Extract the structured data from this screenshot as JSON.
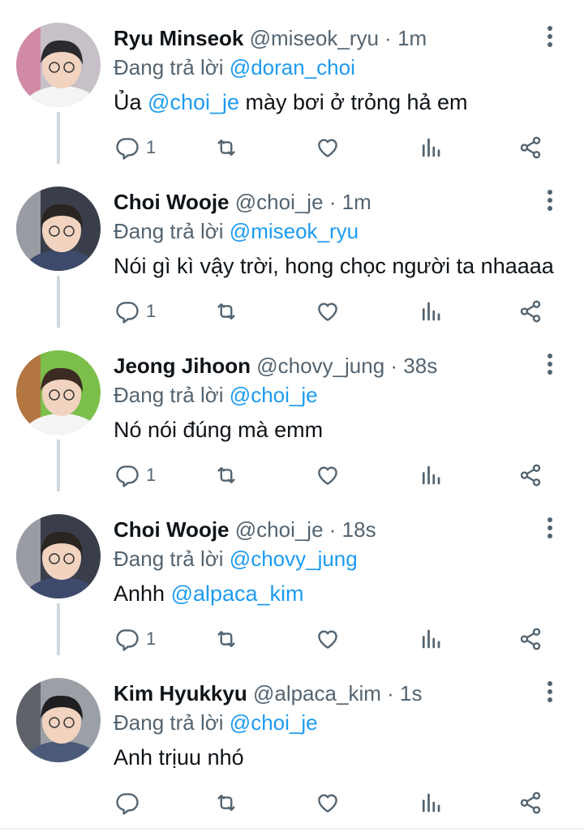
{
  "reply_prefix": "Đang trả lời",
  "colors": {
    "text": "#0f1419",
    "secondary": "#536471",
    "accent": "#1d9bf0",
    "thread": "#cfd9de"
  },
  "tweets": [
    {
      "name": "Ryu Minseok",
      "handle": "@miseok_ryu",
      "time": "1m",
      "reply_to": "@doran_choi",
      "text_before": "Ủa ",
      "text_mention": "@choi_je",
      "text_after": " mày bơi ở trỏng hả em",
      "reply_count": "1"
    },
    {
      "name": "Choi Wooje",
      "handle": "@choi_je",
      "time": "1m",
      "reply_to": "@miseok_ryu",
      "text_before": "Nói gì kì vậy trời, hong chọc người ta nhaaaa",
      "text_mention": "",
      "text_after": "",
      "reply_count": "1"
    },
    {
      "name": "Jeong Jihoon",
      "handle": "@chovy_jung",
      "time": "38s",
      "reply_to": "@choi_je",
      "text_before": "Nó nói đúng mà emm",
      "text_mention": "",
      "text_after": "",
      "reply_count": "1"
    },
    {
      "name": "Choi Wooje",
      "handle": "@choi_je",
      "time": "18s",
      "reply_to": "@chovy_jung",
      "text_before": "Anhh ",
      "text_mention": "@alpaca_kim",
      "text_after": "",
      "reply_count": "1"
    },
    {
      "name": "Kim Hyukkyu",
      "handle": "@alpaca_kim",
      "time": "1s",
      "reply_to": "@choi_je",
      "text_before": "Anh trịuu nhó",
      "text_mention": "",
      "text_after": "",
      "reply_count": ""
    }
  ]
}
